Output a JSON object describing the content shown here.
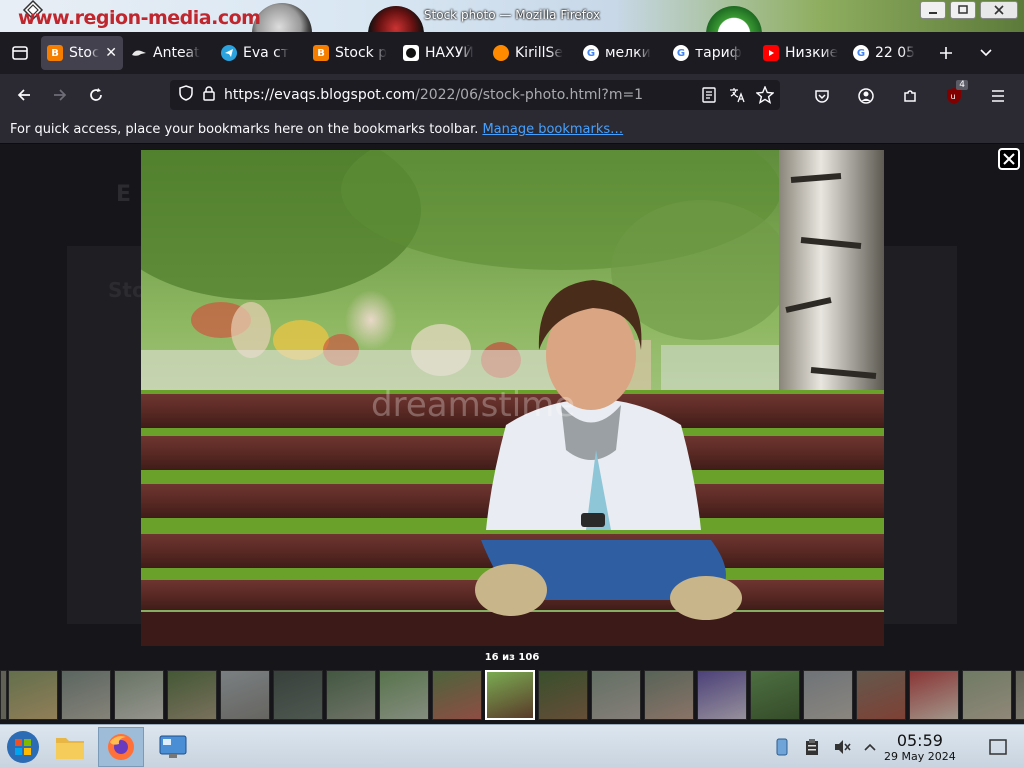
{
  "window": {
    "title": "Stock photo — Mozilla Firefox",
    "banner_text": "www.region-media.com"
  },
  "tabs": [
    {
      "label": "Stock",
      "icon": "blogger-icon",
      "color": "#f57d00",
      "active": true
    },
    {
      "label": "Anteat",
      "icon": "anteater-icon",
      "color": "#222222"
    },
    {
      "label": "Eva ст",
      "icon": "telegram-icon",
      "color": "#2aa3df"
    },
    {
      "label": "Stock p",
      "icon": "blogger-icon",
      "color": "#f57d00"
    },
    {
      "label": "НАХУЙ",
      "icon": "site-icon",
      "color": "#ffffff"
    },
    {
      "label": "KirillSe",
      "icon": "orange-icon",
      "color": "#ff8a00"
    },
    {
      "label": "мелки",
      "icon": "google-icon",
      "color": "#ffffff"
    },
    {
      "label": "тариф",
      "icon": "google-icon",
      "color": "#ffffff"
    },
    {
      "label": "Низкие",
      "icon": "youtube-icon",
      "color": "#ff0000"
    },
    {
      "label": "22 05",
      "icon": "google-icon",
      "color": "#ffffff"
    }
  ],
  "navbar": {
    "url_main": "https://evaqs.blogspot.com",
    "url_rest": "/2022/06/stock-photo.html?m=1",
    "extension_badge": "4"
  },
  "bookmarks": {
    "message": "For quick access, place your bookmarks here on the bookmarks toolbar.",
    "link": "Manage bookmarks…"
  },
  "lightbox": {
    "counter": "16 из 106",
    "watermark": "dreamstime",
    "selected_index": 9,
    "thumbnail_count": 20
  },
  "taskbar": {
    "time": "05:59",
    "date": "29 May 2024"
  }
}
